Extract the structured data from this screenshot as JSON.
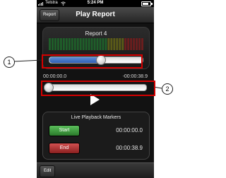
{
  "status_bar": {
    "carrier": "Telstra",
    "time": "5:24 PM",
    "battery_level": 0.8
  },
  "nav": {
    "back_label": "Report",
    "title": "Play Report"
  },
  "player": {
    "report_name": "Report 4",
    "volume_level": 0.55,
    "elapsed": "00:00:00.0",
    "remaining": "-00:00:38.9",
    "playback_position": 0.0
  },
  "markers": {
    "title": "Live Playback Markers",
    "start_label": "Start",
    "start_time": "00:00:00.0",
    "end_label": "End",
    "end_time": "00:00:38.9"
  },
  "toolbar": {
    "edit_label": "Edit"
  },
  "callouts": [
    "1",
    "2"
  ],
  "colors": {
    "highlight": "#d40000",
    "start": "#3a9a3a",
    "end": "#b03030",
    "slider_fill": "#3f70c6"
  },
  "icons": {
    "play": "play-icon",
    "wifi": "wifi-icon",
    "signal": "signal-icon",
    "battery": "battery-icon"
  }
}
